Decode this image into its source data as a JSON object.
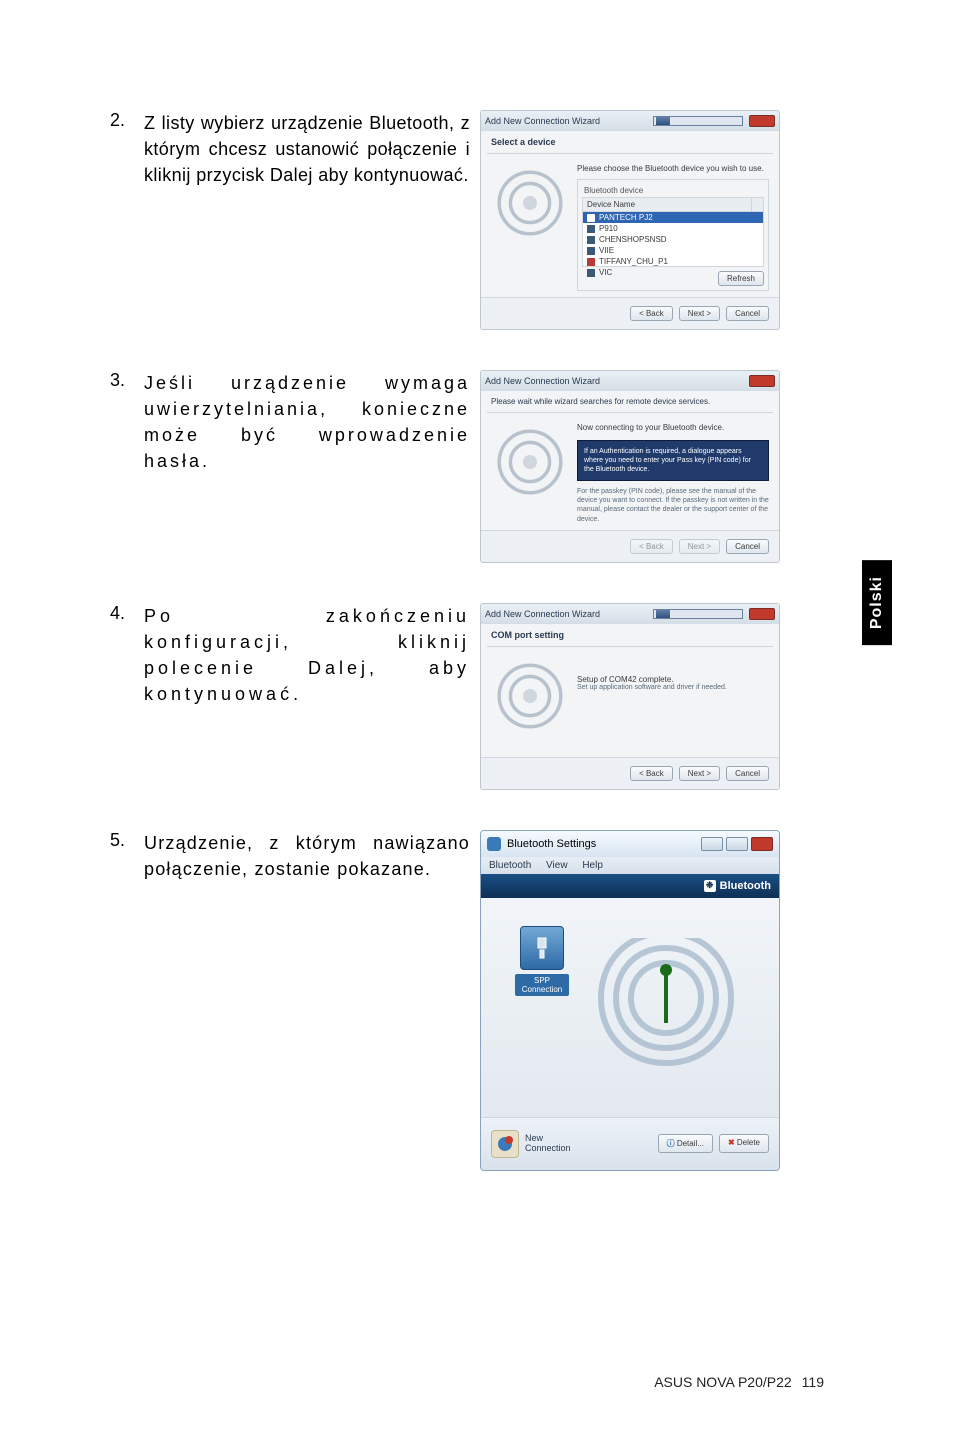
{
  "domain": "Document",
  "steps": {
    "s2": {
      "num": "2.",
      "text": "Z listy wybierz urządzenie Bluetooth, z którym chcesz ustanowić połączenie i kliknij przycisk Dalej aby kontynuować."
    },
    "s3": {
      "num": "3.",
      "text": "Jeśli urządzenie wymaga uwierzytelniania, konieczne może być wprowadzenie hasła."
    },
    "s4": {
      "num": "4.",
      "text": "Po zakończeniu konfiguracji, kliknij polecenie Dalej, aby kontynuować."
    },
    "s5": {
      "num": "5.",
      "text": "Urządzenie, z którym nawiązano połączenie, zostanie pokazane."
    }
  },
  "dlg2": {
    "title": "Add New Connection Wizard",
    "section": "Select a device",
    "hint": "Please choose the Bluetooth device you wish to use.",
    "groupbox": "Bluetooth device",
    "col": "Device Name",
    "rows": [
      "PANTECH PJ2",
      "P910",
      "CHENSHOPSNSD",
      "VIIE",
      "TIFFANY_CHU_P1",
      "VIC"
    ],
    "refresh": "Refresh",
    "back": "< Back",
    "next": "Next >",
    "cancel": "Cancel"
  },
  "dlg3": {
    "title": "Add New Connection Wizard",
    "section": "Please wait while wizard searches for remote device services.",
    "line1": "Now connecting to your Bluetooth device.",
    "bluebox": "If an Authentication is required, a dialogue appears where you need to enter your Pass key (PIN code) for the Bluetooth device.",
    "line2": "For the passkey (PIN code), please see the manual of the device you want to connect. If the passkey is not written in the manual, please contact the dealer or the support center of the device.",
    "back": "< Back",
    "next": "Next >",
    "cancel": "Cancel"
  },
  "dlg4": {
    "title": "Add New Connection Wizard",
    "section": "COM port setting",
    "line1": "Setup of COM42 complete.",
    "line2": "Set up application software and driver if needed.",
    "back": "< Back",
    "next": "Next >",
    "cancel": "Cancel"
  },
  "settings": {
    "title": "Bluetooth Settings",
    "menu": {
      "m1": "Bluetooth",
      "m2": "View",
      "m3": "Help"
    },
    "brand": "Bluetooth",
    "device": {
      "name": "SPP",
      "sub": "Connection"
    },
    "newconn": {
      "l1": "New",
      "l2": "Connection"
    },
    "detail": "Detail...",
    "delete": "Delete"
  },
  "sideTab": "Polski",
  "footer": {
    "product": "ASUS NOVA P20/P22",
    "page": "119"
  }
}
